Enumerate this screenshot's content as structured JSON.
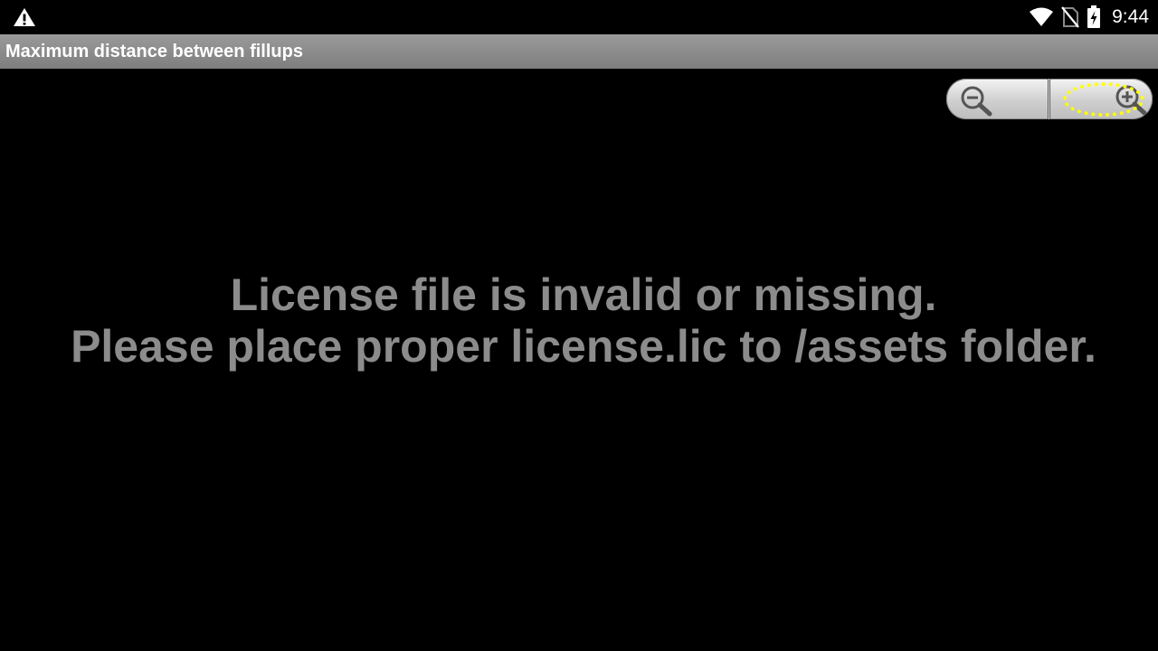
{
  "status_bar": {
    "time": "9:44",
    "icons": [
      "warning-icon",
      "wifi-icon",
      "no-sim-icon",
      "battery-charging-icon"
    ]
  },
  "title_bar": {
    "title": "Maximum distance between fillups"
  },
  "zoom_controls": {
    "zoom_out_icon": "zoom-out-magnifier-icon",
    "zoom_in_icon": "zoom-in-magnifier-icon",
    "focus_highlight_color": "#ffff00"
  },
  "message": {
    "line1": "License file is invalid or missing.",
    "line2": "Please place proper license.lic to /assets folder.",
    "color": "#8c8c8c"
  }
}
